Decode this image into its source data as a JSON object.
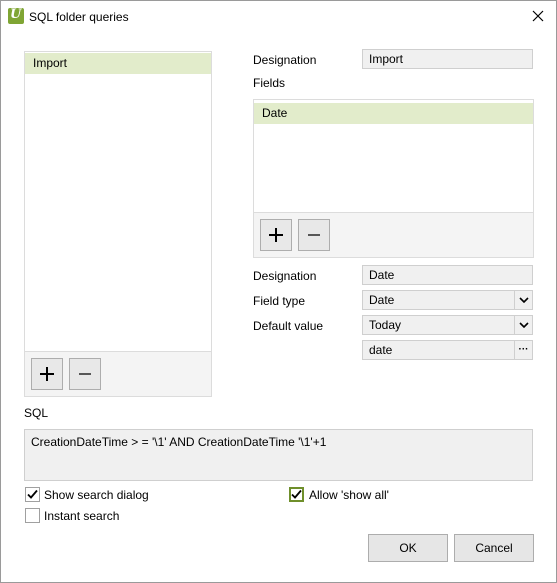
{
  "window": {
    "title": "SQL folder queries",
    "app_icon_letter": "U"
  },
  "queries": {
    "items": [
      {
        "label": "Import",
        "selected": true
      }
    ]
  },
  "detail": {
    "designation_label": "Designation",
    "designation_value": "Import",
    "fields_label": "Fields",
    "fields_items": [
      {
        "label": "Date",
        "selected": true
      }
    ]
  },
  "field_detail": {
    "designation_label": "Designation",
    "designation_value": "Date",
    "field_type_label": "Field type",
    "field_type_value": "Date",
    "default_value_label": "Default value",
    "default_value_value": "Today",
    "extra_value": "date",
    "ellipsis_label": "···"
  },
  "sql": {
    "label": "SQL",
    "query": "CreationDateTime > = '\\1' AND CreationDateTime '\\1'+1"
  },
  "options": {
    "show_search_dialog": {
      "label": "Show search dialog",
      "checked": true
    },
    "allow_show_all": {
      "label": "Allow 'show all'",
      "checked": true
    },
    "instant_search": {
      "label": "Instant search",
      "checked": false
    }
  },
  "buttons": {
    "ok": "OK",
    "cancel": "Cancel"
  },
  "colors": {
    "accent": "#7fa534",
    "selection": "#e2eccb",
    "focus_border": "#6f8f2b"
  }
}
